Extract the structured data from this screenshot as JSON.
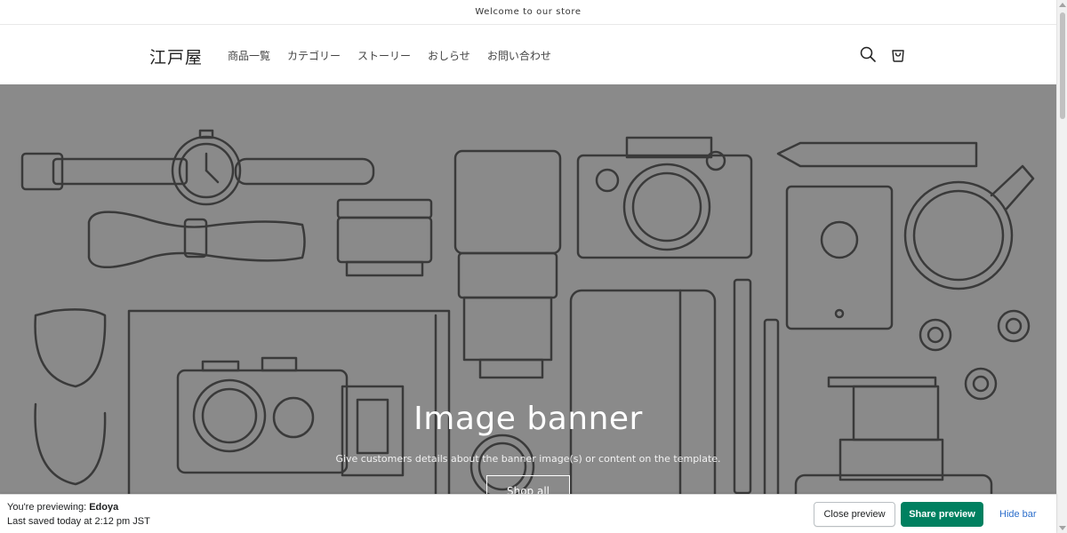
{
  "announcement": {
    "text": "Welcome to our store"
  },
  "header": {
    "logo": "江戸屋",
    "nav": [
      {
        "label": "商品一覧"
      },
      {
        "label": "カテゴリー"
      },
      {
        "label": "ストーリー"
      },
      {
        "label": "おしらせ"
      },
      {
        "label": "お問い合わせ"
      }
    ],
    "icons": {
      "search": "search-icon",
      "cart": "cart-icon"
    }
  },
  "banner": {
    "title": "Image banner",
    "subtitle": "Give customers details about the banner image(s) or content on the template.",
    "button": "Shop all",
    "overlay_color": "#8a8a8a"
  },
  "preview_bar": {
    "previewing_prefix": "You're previewing: ",
    "store_name": "Edoya",
    "last_saved": "Last saved today at 2:12 pm JST",
    "close_label": "Close preview",
    "share_label": "Share preview",
    "hide_label": "Hide bar",
    "share_color": "#008060",
    "link_color": "#2c6ecb"
  }
}
